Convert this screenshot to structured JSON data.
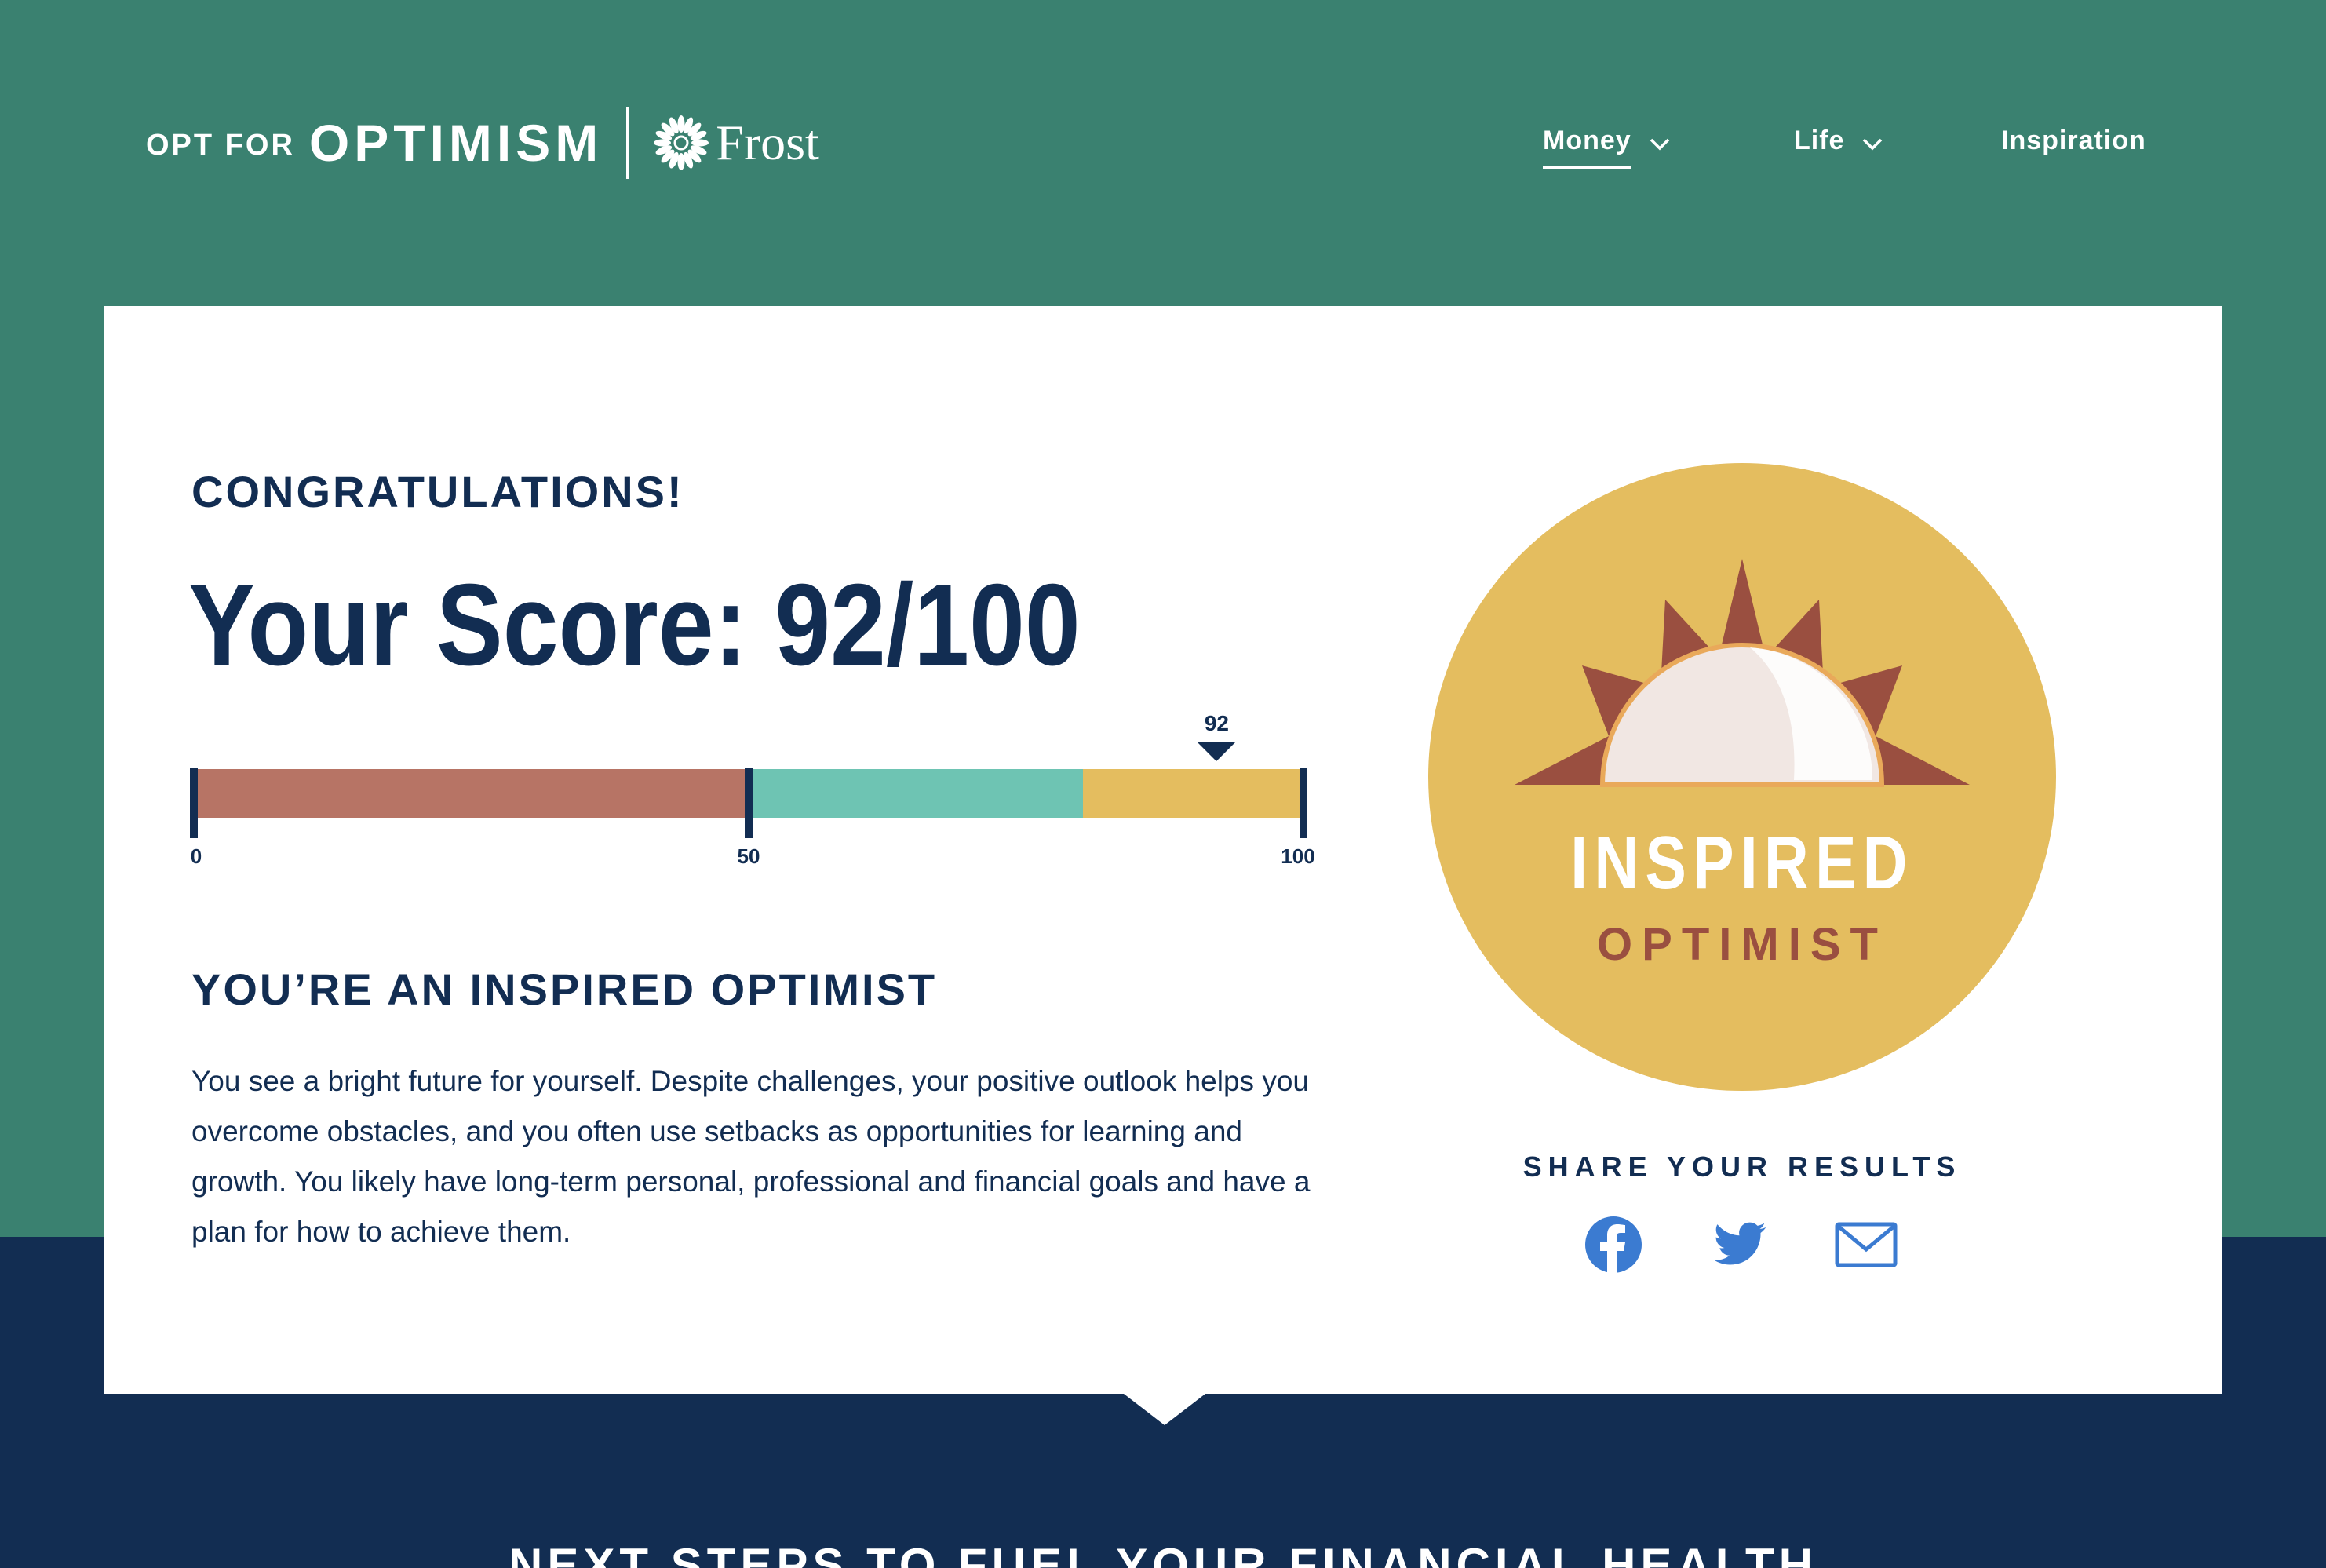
{
  "header": {
    "logo": {
      "opt_for": "OPT FOR",
      "optimism": "OPTIMISM",
      "frost": "Frost"
    },
    "nav": [
      {
        "label": "Money",
        "has_dropdown": true,
        "active": true
      },
      {
        "label": "Life",
        "has_dropdown": true,
        "active": false
      },
      {
        "label": "Inspiration",
        "has_dropdown": false,
        "active": false
      }
    ]
  },
  "result": {
    "congrats": "CONGRATULATIONS!",
    "score_heading": "Your Score: 92/100",
    "score": 92,
    "score_max": 100,
    "bar": {
      "marker_label": "92",
      "ticks": [
        "0",
        "50",
        "100"
      ],
      "segments": [
        {
          "from": 0,
          "to": 50,
          "color": "#b77465"
        },
        {
          "from": 50,
          "to": 80,
          "color": "#6ec4b3"
        },
        {
          "from": 80,
          "to": 100,
          "color": "#e4bd5f"
        }
      ]
    },
    "title": "YOU’RE AN INSPIRED OPTIMIST",
    "description": "You see a bright future for yourself. Despite challenges, your positive outlook helps you overcome obstacles, and you often use setbacks as opportunities for learning and growth. You likely have long-term personal, professional and financial goals and have a plan for how to achieve them."
  },
  "badge": {
    "line1": "INSPIRED",
    "line2": "OPTIMIST",
    "colors": {
      "circle": "#e4bd5f",
      "rays": "#9a4f40",
      "sun": "#f1e7e3"
    }
  },
  "share": {
    "title": "SHARE YOUR RESULTS",
    "icons": [
      "facebook-icon",
      "twitter-icon",
      "email-icon"
    ]
  },
  "footer_heading": "NEXT STEPS TO FUEL YOUR FINANCIAL HEALTH",
  "colors": {
    "green": "#3a8170",
    "navy": "#122d52",
    "share_blue": "#3b7bd1"
  }
}
